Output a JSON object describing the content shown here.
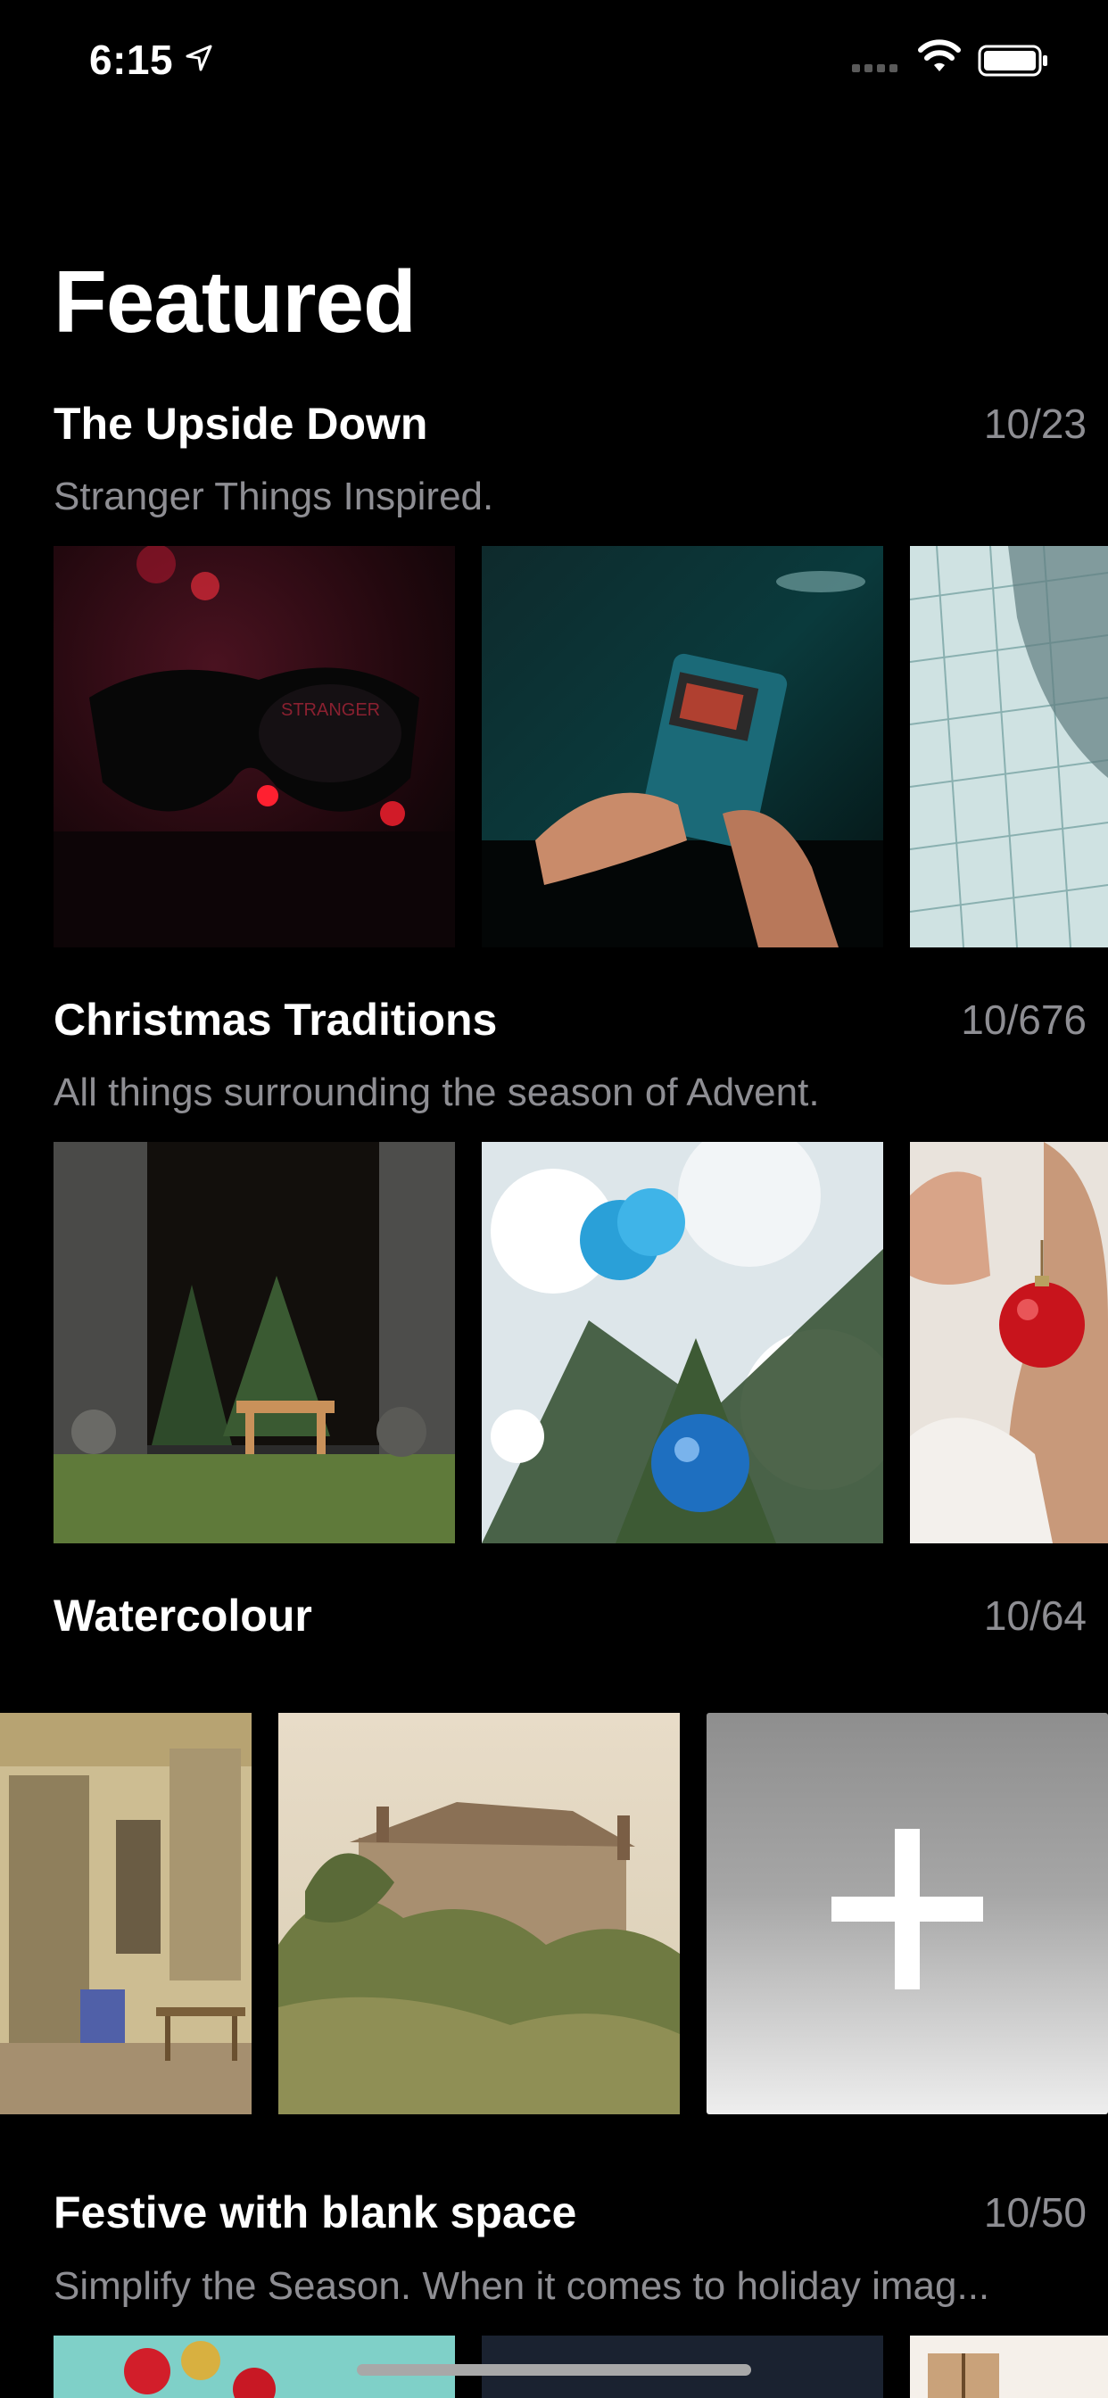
{
  "status_bar": {
    "time": "6:15"
  },
  "page_title": "Featured",
  "sections": [
    {
      "title": "The Upside Down",
      "count": "10/23",
      "subtitle": "Stranger Things Inspired."
    },
    {
      "title": "Christmas Traditions",
      "count": "10/676",
      "subtitle": "All things surrounding the season of Advent."
    },
    {
      "title": "Watercolour",
      "count": "10/64",
      "subtitle": ""
    },
    {
      "title": "Festive with blank space",
      "count": "10/50",
      "subtitle": "Simplify the Season. When it comes to holiday imag..."
    }
  ],
  "icons": {
    "location": "location-arrow-icon",
    "wifi": "wifi-icon",
    "battery": "battery-icon",
    "add": "plus-icon"
  },
  "colors": {
    "background": "#000000",
    "secondary_text": "#8e8e93"
  }
}
